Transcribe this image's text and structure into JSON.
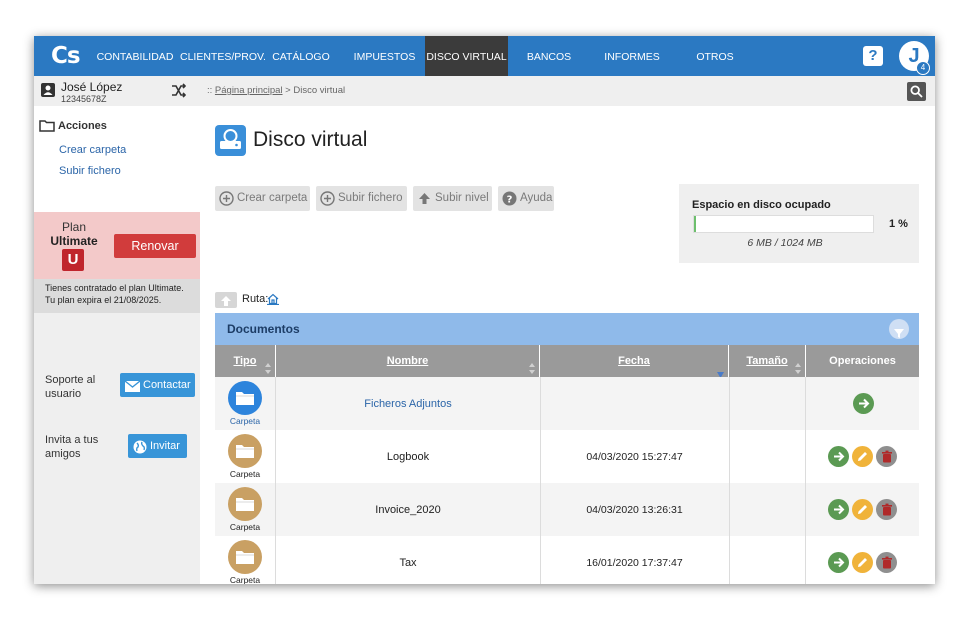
{
  "nav": {
    "logo": "Cs",
    "items": [
      "CONTABILIDAD",
      "CLIENTES/PROV.",
      "CATÁLOGO",
      "IMPUESTOS",
      "DISCO VIRTUAL",
      "BANCOS",
      "INFORMES",
      "OTROS"
    ],
    "active": "DISCO VIRTUAL",
    "help_label": "?",
    "avatar_letter": "J",
    "avatar_badge": "4"
  },
  "user": {
    "name": "José López",
    "id": "12345678Z"
  },
  "sidebar": {
    "actions_title": "Acciones",
    "links": [
      "Crear carpeta",
      "Subir fichero"
    ],
    "plan_label": "Plan",
    "plan_name": "Ultimate",
    "plan_badge": "U",
    "renew_label": "Renovar",
    "plan_info_1": "Tienes contratado el plan Ultimate.",
    "plan_info_2": "Tu plan expira el 21/08/2025.",
    "support_text": "Soporte al usuario",
    "contact_label": "Contactar",
    "invite_text": "Invita a tus amigos",
    "invite_label": "Invitar"
  },
  "breadcrumb": {
    "prefix": "::",
    "home": "Página principal",
    "sep": ">",
    "current": "Disco virtual"
  },
  "page": {
    "title": "Disco virtual"
  },
  "toolbar": {
    "create_folder": "Crear carpeta",
    "upload_file": "Subir fichero",
    "up_level": "Subir nivel",
    "help": "Ayuda"
  },
  "disk": {
    "title": "Espacio en disco ocupado",
    "percent_label": "1 %",
    "percent_value": 1,
    "size_text": "6 MB / 1024 MB"
  },
  "path": {
    "label": "Ruta:"
  },
  "documents": {
    "title": "Documentos",
    "columns": [
      "Tipo",
      "Nombre",
      "Fecha",
      "Tamaño",
      "Operaciones"
    ],
    "rows": [
      {
        "type": "Carpeta",
        "name": "Ficheros Adjuntos",
        "date": "",
        "size": "",
        "special": true
      },
      {
        "type": "Carpeta",
        "name": "Logbook",
        "date": "04/03/2020 15:27:47",
        "size": ""
      },
      {
        "type": "Carpeta",
        "name": "Invoice_2020",
        "date": "04/03/2020 13:26:31",
        "size": ""
      },
      {
        "type": "Carpeta",
        "name": "Tax",
        "date": "16/01/2020 17:37:47",
        "size": ""
      }
    ]
  },
  "colors": {
    "nav_bg": "#2b79c2",
    "nav_active": "#3b3b3b",
    "accent": "#3895d8",
    "renew": "#d13c3c",
    "plan_bg": "#f3c9c9",
    "folder_special": "#2d84dc",
    "folder": "#c9a063",
    "op_open": "#5b9a53",
    "op_edit": "#f0b33a",
    "op_delete": "#8f8f8f"
  }
}
